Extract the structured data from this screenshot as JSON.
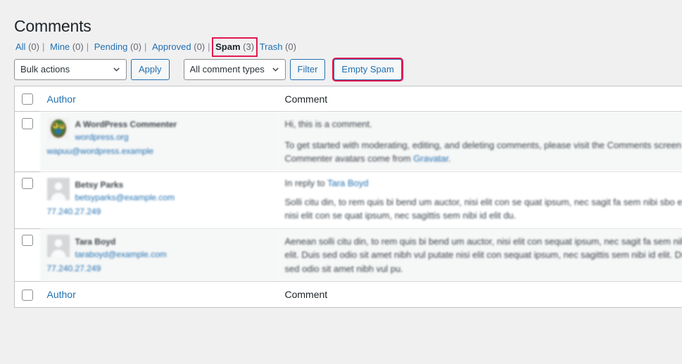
{
  "page": {
    "title": "Comments"
  },
  "status_links": [
    {
      "label": "All",
      "count": "(0)",
      "current": false,
      "highlighted": false
    },
    {
      "label": "Mine",
      "count": "(0)",
      "current": false,
      "highlighted": false
    },
    {
      "label": "Pending",
      "count": "(0)",
      "current": false,
      "highlighted": false
    },
    {
      "label": "Approved",
      "count": "(0)",
      "current": false,
      "highlighted": false
    },
    {
      "label": "Spam",
      "count": "(3)",
      "current": true,
      "highlighted": true
    },
    {
      "label": "Trash",
      "count": "(0)",
      "current": false,
      "highlighted": false
    }
  ],
  "separator": "|",
  "toolbar": {
    "bulk_actions_value": "Bulk actions",
    "apply_label": "Apply",
    "comment_types_value": "All comment types",
    "filter_label": "Filter",
    "empty_spam_label": "Empty Spam",
    "chevron_icon": "chevron-down-icon"
  },
  "table": {
    "columns": {
      "author": "Author",
      "comment": "Comment"
    },
    "rows": [
      {
        "author_name": "A WordPress Commenter",
        "author_site": "wordpress.org",
        "author_email": "wapuu@wordpress.example",
        "author_ip": "",
        "avatar": "gravatar-wapuu-avatar",
        "reply_to_prefix": "",
        "reply_to_name": "",
        "comment_lines": [
          "Hi, this is a comment.",
          "To get started with moderating, editing, and deleting comments, please visit the Comments screen in",
          "Commenter avatars come from "
        ],
        "comment_link": "Gravatar",
        "comment_link_suffix": "."
      },
      {
        "author_name": "Betsy Parks",
        "author_site": "",
        "author_email": "betsyparks@example.com",
        "author_ip": "77.240.27.249",
        "avatar": "default-person-avatar",
        "reply_to_prefix": "In reply to ",
        "reply_to_name": "Tara Boyd",
        "comment_lines": [
          "Solli citu din, to rem quis bi bend um auctor, nisi elit con se quat ipsum, nec sagit fa sem nibi sbo el",
          "nisi elit con se quat ipsum, nec sagittis sem nibi id elit du."
        ],
        "comment_link": "",
        "comment_link_suffix": ""
      },
      {
        "author_name": "Tara Boyd",
        "author_site": "",
        "author_email": "taraboyd@example.com",
        "author_ip": "77.240.27.249",
        "avatar": "default-person-avatar",
        "reply_to_prefix": "",
        "reply_to_name": "",
        "comment_lines": [
          "Aenean solli citu din, to rem quis bi bend um auctor, nisi elit con sequat ipsum, nec sagit fa sem nibi",
          "elit. Duis sed odio sit amet nibh vul putate nisi elit con sequat ipsum, nec sagittis sem nibi id elit. Du",
          "sed odio sit amet nibh vul pu."
        ],
        "comment_link": "",
        "comment_link_suffix": ""
      }
    ]
  },
  "colors": {
    "highlight": "#e3194f",
    "link": "#2271b1",
    "heading": "#1d2327",
    "page_bg": "#f0f0f1",
    "row_alt_bg": "#f6f7f7"
  }
}
